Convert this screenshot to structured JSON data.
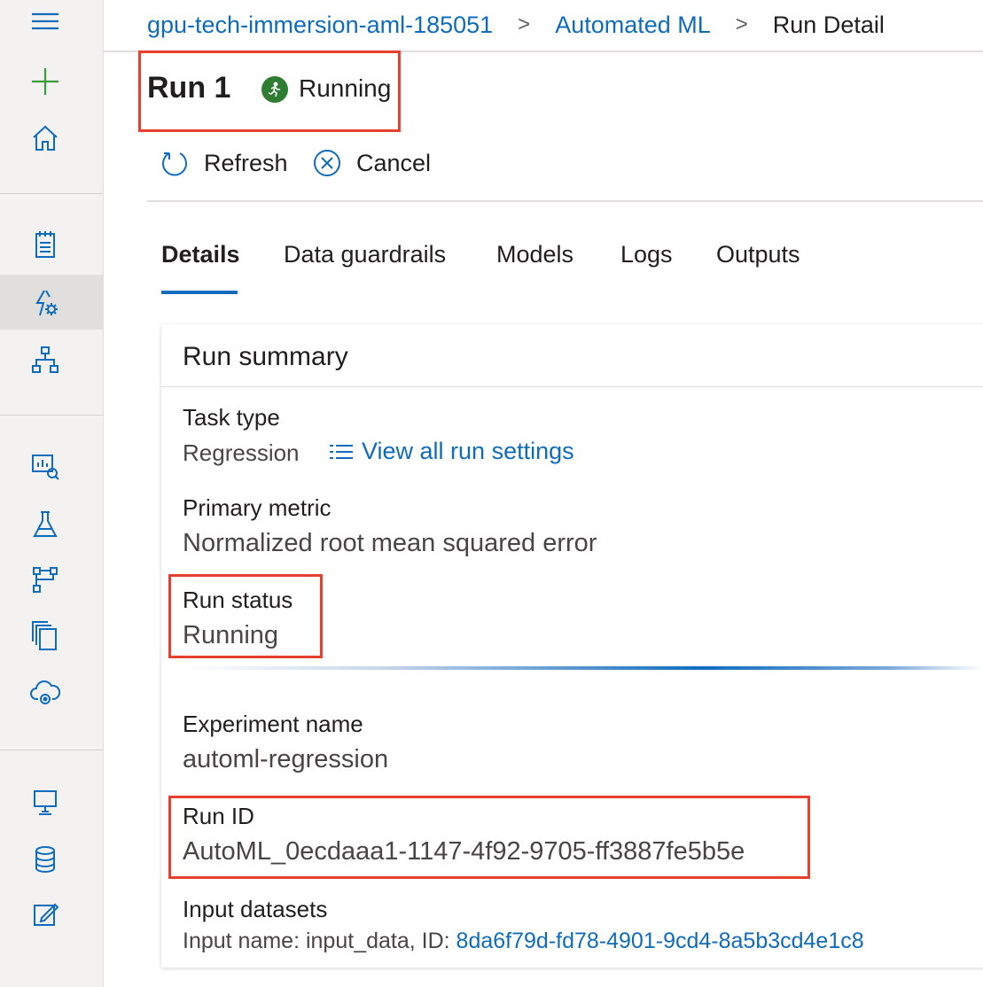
{
  "breadcrumb": {
    "workspace": "gpu-tech-immersion-aml-185051",
    "section": "Automated ML",
    "current": "Run Detail",
    "separator": ">"
  },
  "header": {
    "title": "Run 1",
    "status": "Running",
    "status_color": "#2f7d32"
  },
  "toolbar": {
    "refresh_label": "Refresh",
    "cancel_label": "Cancel"
  },
  "tabs": [
    {
      "label": "Details",
      "active": true
    },
    {
      "label": "Data guardrails",
      "active": false
    },
    {
      "label": "Models",
      "active": false
    },
    {
      "label": "Logs",
      "active": false
    },
    {
      "label": "Outputs",
      "active": false
    }
  ],
  "summary": {
    "heading": "Run summary",
    "task_type_label": "Task type",
    "task_type_value": "Regression",
    "view_settings_link": "View all run settings",
    "primary_metric_label": "Primary metric",
    "primary_metric_value": "Normalized root mean squared error",
    "run_status_label": "Run status",
    "run_status_value": "Running",
    "experiment_name_label": "Experiment name",
    "experiment_name_value": "automl-regression",
    "run_id_label": "Run ID",
    "run_id_value": "AutoML_0ecdaaa1-1147-4f92-9705-ff3887fe5b5e",
    "input_datasets_label": "Input datasets",
    "input_prefix": "Input name: input_data, ID:",
    "input_id": "8da6f79d-fd78-4901-9cd4-8a5b3cd4e1c8"
  },
  "colors": {
    "accent": "#0f6cbd",
    "highlight": "#e8402e",
    "rail_bg": "#f3f2f1",
    "plus_icon": "#3a9b3a"
  },
  "rail_icons": [
    "hamburger-icon",
    "plus-icon",
    "home-icon",
    "notebook-icon",
    "automl-icon",
    "designer-icon",
    "datasets-icon",
    "experiments-icon",
    "pipelines-icon",
    "models-icon",
    "endpoints-icon",
    "compute-icon",
    "datastores-icon",
    "labeling-icon"
  ]
}
